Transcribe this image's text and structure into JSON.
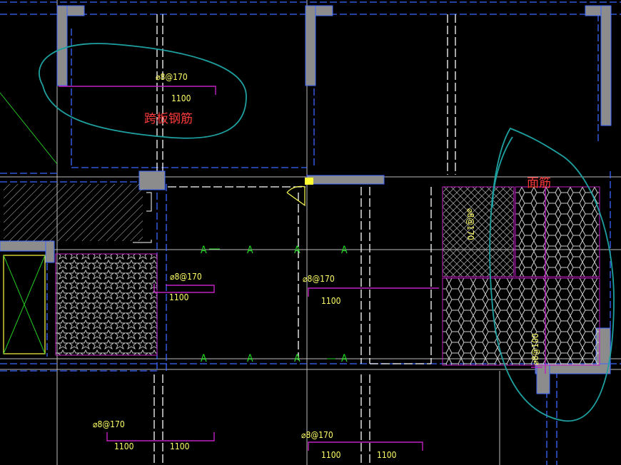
{
  "colors": {
    "background": "#000000",
    "wall": "#8c8c8c",
    "blue_dashed": "#3a66ff",
    "white_dashed": "#ffffff",
    "magenta": "#c020c0",
    "yellow_text": "#ffff66",
    "red_note": "#ff3b3b",
    "cyan_cloud": "#1ea0a0",
    "green_axis": "#22dd22",
    "hatch": "#bbbbbb"
  },
  "annotations": {
    "cross_rebar_note": "跨板钢筋",
    "top_rebar_note": "面筋"
  },
  "rebar_specs": [
    "⌀8@170",
    "⌀8@170",
    "⌀8@170",
    "⌀8@170",
    "⌀8@170",
    "⌀8@170",
    "⌀8@100"
  ],
  "lengths": [
    "1100",
    "1100",
    "1100",
    "1100",
    "1100",
    "1100",
    "1100"
  ],
  "axis_markers": [
    "A",
    "A",
    "A",
    "A",
    "A",
    "A",
    "A",
    "A"
  ],
  "icons": {
    "door_swing": "door-swing-arc-icon",
    "section_hatch": "diagonal-hatch-icon",
    "cloud_revision": "revision-cloud-icon"
  }
}
